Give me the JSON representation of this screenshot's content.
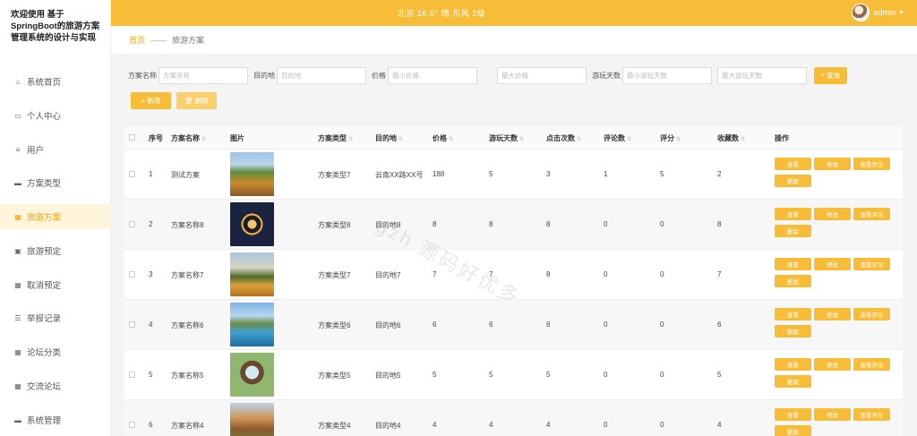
{
  "sidebar": {
    "brand": "欢迎使用 基于SpringBoot的旅游方案管理系统的设计与实现",
    "items": [
      {
        "label": "系统首页",
        "icon": "home-icon"
      },
      {
        "label": "个人中心",
        "icon": "profile-icon"
      },
      {
        "label": "用户",
        "icon": "user-icon"
      },
      {
        "label": "方案类型",
        "icon": "type-icon"
      },
      {
        "label": "旅游方案",
        "icon": "grid-icon",
        "active": true
      },
      {
        "label": "旅游预定",
        "icon": "booking-icon"
      },
      {
        "label": "取消预定",
        "icon": "grid-icon"
      },
      {
        "label": "举报记录",
        "icon": "list-icon"
      },
      {
        "label": "论坛分类",
        "icon": "grid-icon"
      },
      {
        "label": "交流论坛",
        "icon": "grid-icon"
      },
      {
        "label": "系统管理",
        "icon": "monitor-icon"
      }
    ]
  },
  "topbar": {
    "weather": "北京  16.6°  晴  东风  2级",
    "user": "admin",
    "accent": "#f7bd39"
  },
  "breadcrumb": {
    "home": "首页",
    "sep": "——",
    "current": "旅游方案"
  },
  "search": {
    "name_label": "方案名称",
    "name_placeholder": "方案名称",
    "dest_label": "目的地",
    "dest_placeholder": "目的地",
    "price_label": "价格",
    "price_min_placeholder": "最小价格",
    "price_max_placeholder": "最大价格",
    "days_label": "游玩天数",
    "days_min_placeholder": "最小游玩天数",
    "days_max_placeholder": "最大游玩天数",
    "query_button": "查询"
  },
  "actions": {
    "add": "+ 新增",
    "delete": "删除"
  },
  "table": {
    "headers": [
      "序号",
      "方案名称",
      "图片",
      "方案类型",
      "目的地",
      "价格",
      "游玩天数",
      "点击次数",
      "评论数",
      "评分",
      "收藏数",
      "操作"
    ],
    "row_buttons": [
      "查看",
      "修改",
      "查看评论",
      "删除"
    ],
    "rows": [
      {
        "no": "1",
        "name": "测试方案",
        "type": "方案类型7",
        "dest": "云南XX路XX号",
        "price": "188",
        "days": "5",
        "clicks": "3",
        "comments": "1",
        "score": "5",
        "favs": "2",
        "img": "scene-garden"
      },
      {
        "no": "2",
        "name": "方案名称8",
        "type": "方案类型8",
        "dest": "目的地8",
        "price": "8",
        "days": "8",
        "clicks": "8",
        "comments": "0",
        "score": "0",
        "favs": "8",
        "img": "scene-night"
      },
      {
        "no": "3",
        "name": "方案名称7",
        "type": "方案类型7",
        "dest": "目的地7",
        "price": "7",
        "days": "7",
        "clicks": "8",
        "comments": "0",
        "score": "0",
        "favs": "7",
        "img": "scene-flowers"
      },
      {
        "no": "4",
        "name": "方案名称6",
        "type": "方案类型6",
        "dest": "目的地6",
        "price": "6",
        "days": "6",
        "clicks": "6",
        "comments": "0",
        "score": "0",
        "favs": "6",
        "img": "scene-lake"
      },
      {
        "no": "5",
        "name": "方案名称5",
        "type": "方案类型5",
        "dest": "目的地5",
        "price": "5",
        "days": "5",
        "clicks": "5",
        "comments": "0",
        "score": "0",
        "favs": "5",
        "img": "scene-ring"
      },
      {
        "no": "6",
        "name": "方案名称4",
        "type": "方案类型4",
        "dest": "目的地4",
        "price": "4",
        "days": "4",
        "clicks": "4",
        "comments": "0",
        "score": "0",
        "favs": "4",
        "img": "scene-arch"
      }
    ]
  },
  "watermark": "gzh 源码好优多"
}
